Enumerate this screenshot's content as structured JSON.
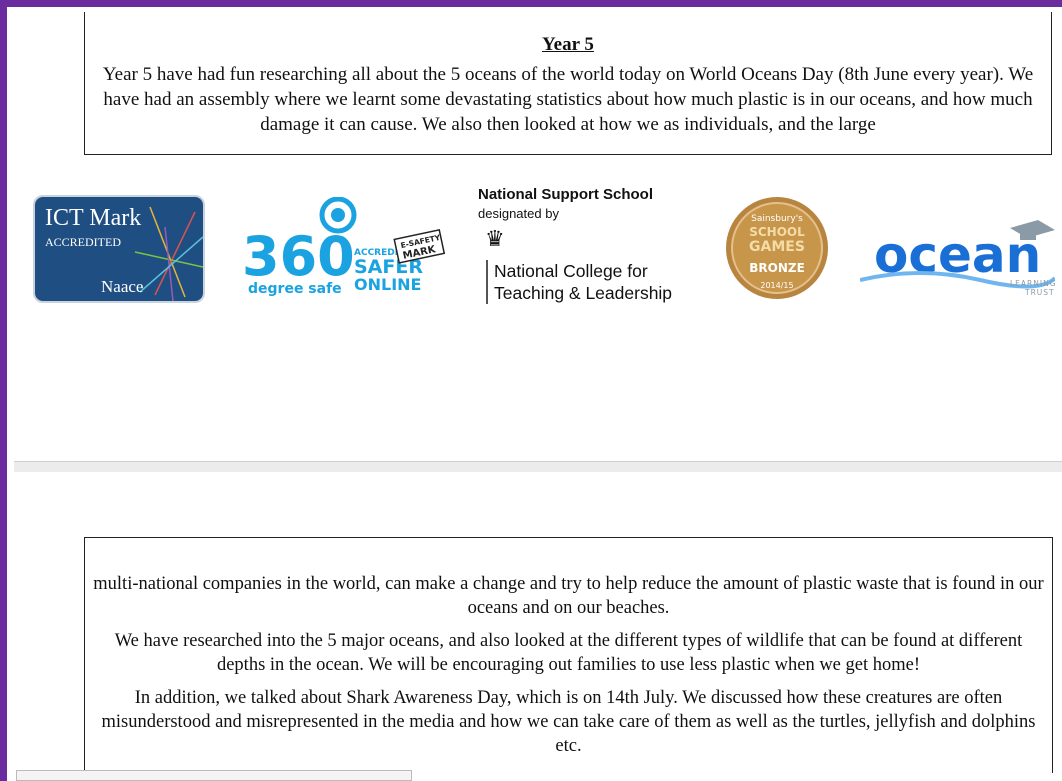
{
  "top_box": {
    "title": "Year 5",
    "paragraph": "Year 5 have had fun researching all about the 5 oceans of the world today on World Oceans Day (8th June every year). We have had an assembly where we learnt some devastating statistics about how much plastic is in our oceans, and how much damage it can cause. We also then looked at how we as individuals, and the large"
  },
  "logos": {
    "ict_mark": {
      "title": "ICT Mark",
      "sub": "ACCREDITED",
      "org": "Naace"
    },
    "safe_360": {
      "big": "360",
      "sub": "degree safe",
      "acc": "ACCREDITED",
      "safer": "SAFER",
      "online": "ONLINE",
      "esafety": "E-SAFETY",
      "mark": "MARK"
    },
    "national_support": {
      "title": "National Support School",
      "designated": "designated by",
      "line1": "National College for",
      "line2": "Teaching & Leadership"
    },
    "school_games": {
      "top": "Sainsbury's",
      "school": "SCHOOL",
      "games": "GAMES",
      "level": "BRONZE",
      "year": "2014/15"
    },
    "ocean": {
      "name": "ocean",
      "sub1": "LEARNING",
      "sub2": "TRUST"
    }
  },
  "bottom_box": {
    "p1": "multi-national companies in the world, can make a change and try to help reduce the amount of plastic waste that is found in our oceans and on our beaches.",
    "p2": "We have researched into the 5 major oceans, and also looked at the different types of wildlife that can be found at different depths in the ocean. We will be encouraging out families to use less plastic when we get home!",
    "p3": "In addition, we talked about Shark Awareness Day, which is on 14th July. We discussed how these creatures are often misunderstood and misrepresented in the media and how we can take care of them as well as the turtles, jellyfish and dolphins etc."
  },
  "colors": {
    "frame": "#6a2c9e",
    "ict_bg": "#1f4f82",
    "safe_blue": "#1aa3e0",
    "games_gold": "#c8964a",
    "ocean_blue": "#1a6fd6"
  }
}
